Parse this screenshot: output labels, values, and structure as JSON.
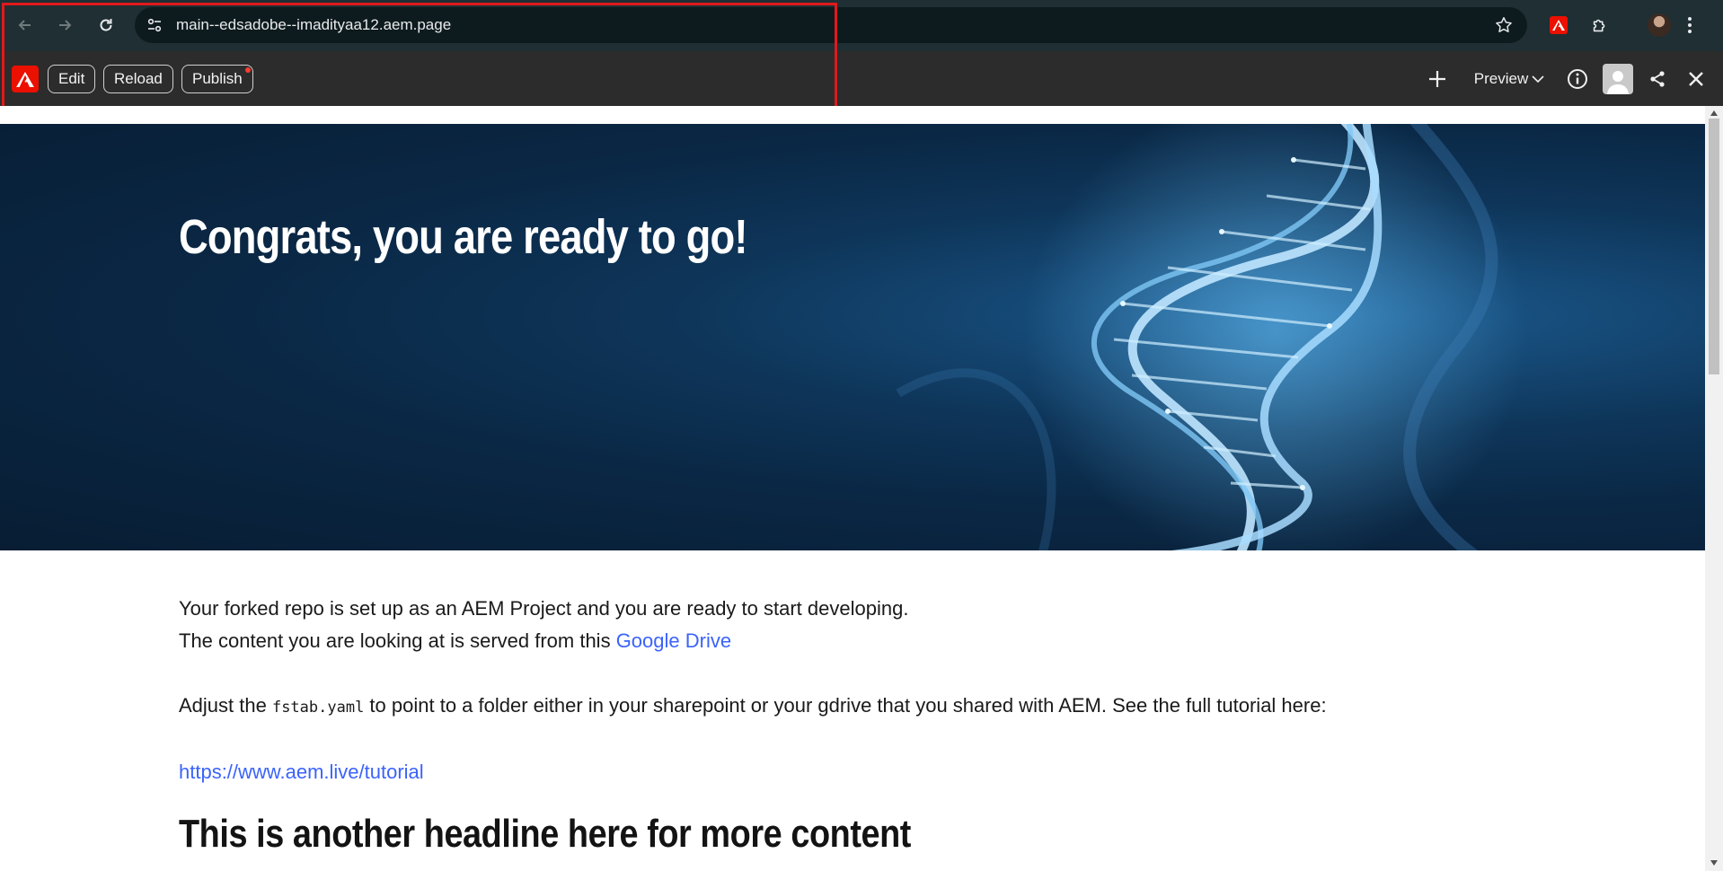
{
  "browser": {
    "url": "main--edsadobe--imadityaa12.aem.page",
    "icons": {
      "back": "arrow-left-icon",
      "forward": "arrow-right-icon",
      "reload": "reload-icon",
      "site_info": "tune-icon",
      "bookmark": "star-icon",
      "extension_adobe": "adobe-icon",
      "extensions": "puzzle-icon",
      "profile": "avatar",
      "menu": "kebab-icon"
    }
  },
  "sidekick": {
    "edit_label": "Edit",
    "reload_label": "Reload",
    "publish_label": "Publish",
    "preview_label": "Preview",
    "accent_color": "#eb1000"
  },
  "hero": {
    "title": "Congrats, you are ready to go!"
  },
  "content": {
    "para1_line1": "Your forked repo is set up as an AEM Project and you are ready to start developing.",
    "para1_line2_prefix": "The content you are looking at is served from this ",
    "para1_link": "Google Drive",
    "para2_prefix": "Adjust the ",
    "para2_code": "fstab.yaml",
    "para2_suffix": " to point to a folder either in your sharepoint or your gdrive that you shared with AEM. See the full tutorial here:",
    "tutorial_link": "https://www.aem.live/tutorial",
    "headline2": "This is another headline here for more content",
    "link_color": "#3b63fb"
  }
}
